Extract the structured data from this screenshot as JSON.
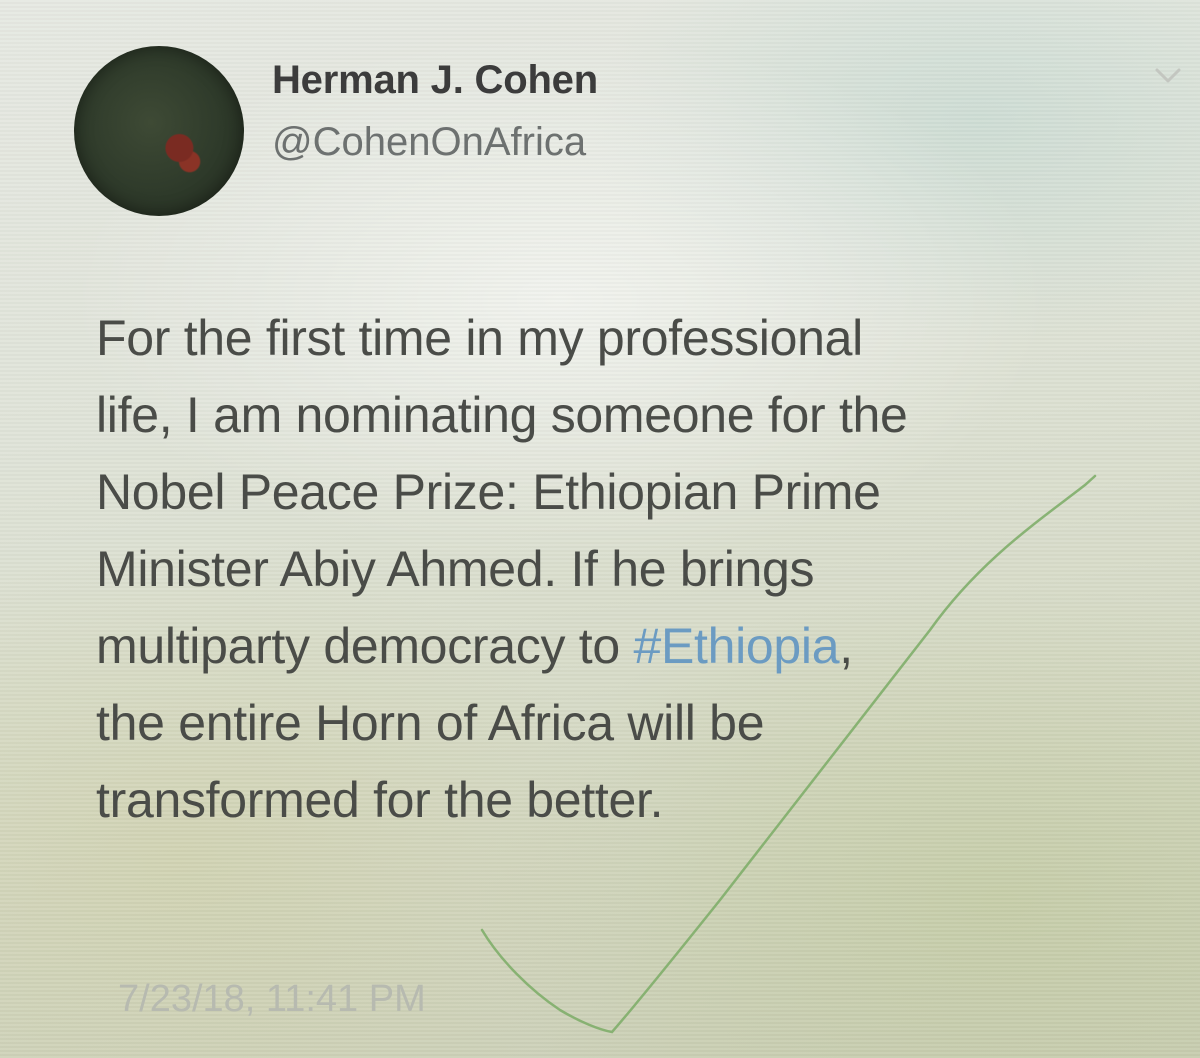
{
  "tweet": {
    "author_name": "Herman J. Cohen",
    "author_handle": "@CohenOnAfrica",
    "avatar_icon": "profile-photo-avatar",
    "menu_icon": "chevron-down-icon",
    "body": {
      "line1": "For the first time in my professional",
      "line2": "life, I am nominating someone for the",
      "line3": "Nobel Peace Prize: Ethiopian Prime",
      "line4": "Minister Abiy Ahmed. If he brings",
      "line5_before": "multiparty democracy to ",
      "line5_hashtag": "#Ethiopia",
      "line5_after": ",",
      "line6": "the entire Horn of Africa will be",
      "line7": "transformed for the better."
    },
    "timestamp": "7/23/18, 11:41 PM"
  },
  "colors": {
    "hashtag": "#6b9bc2",
    "body_text": "#4a4c48",
    "handle": "#6d7170",
    "check_mark": "#7fae6a"
  }
}
